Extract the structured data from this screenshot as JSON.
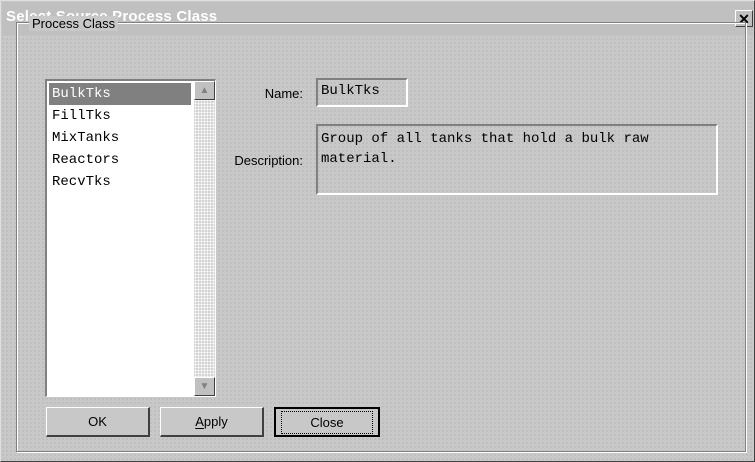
{
  "window": {
    "title": "Select Source Process Class",
    "close_glyph": "✕"
  },
  "group": {
    "label": "Process Class"
  },
  "list": {
    "items": [
      "BulkTks",
      "FillTks",
      "MixTanks",
      "Reactors",
      "RecvTks"
    ],
    "selected": "BulkTks"
  },
  "form": {
    "name_label": "Name:",
    "name_value": "BulkTks",
    "description_label": "Description:",
    "description_value": "Group of all tanks that hold a bulk raw material."
  },
  "buttons": {
    "ok": "OK",
    "apply": "Apply",
    "close": "Close"
  },
  "icons": {
    "scroll_up": "up-arrow-icon",
    "scroll_down": "down-arrow-icon"
  }
}
